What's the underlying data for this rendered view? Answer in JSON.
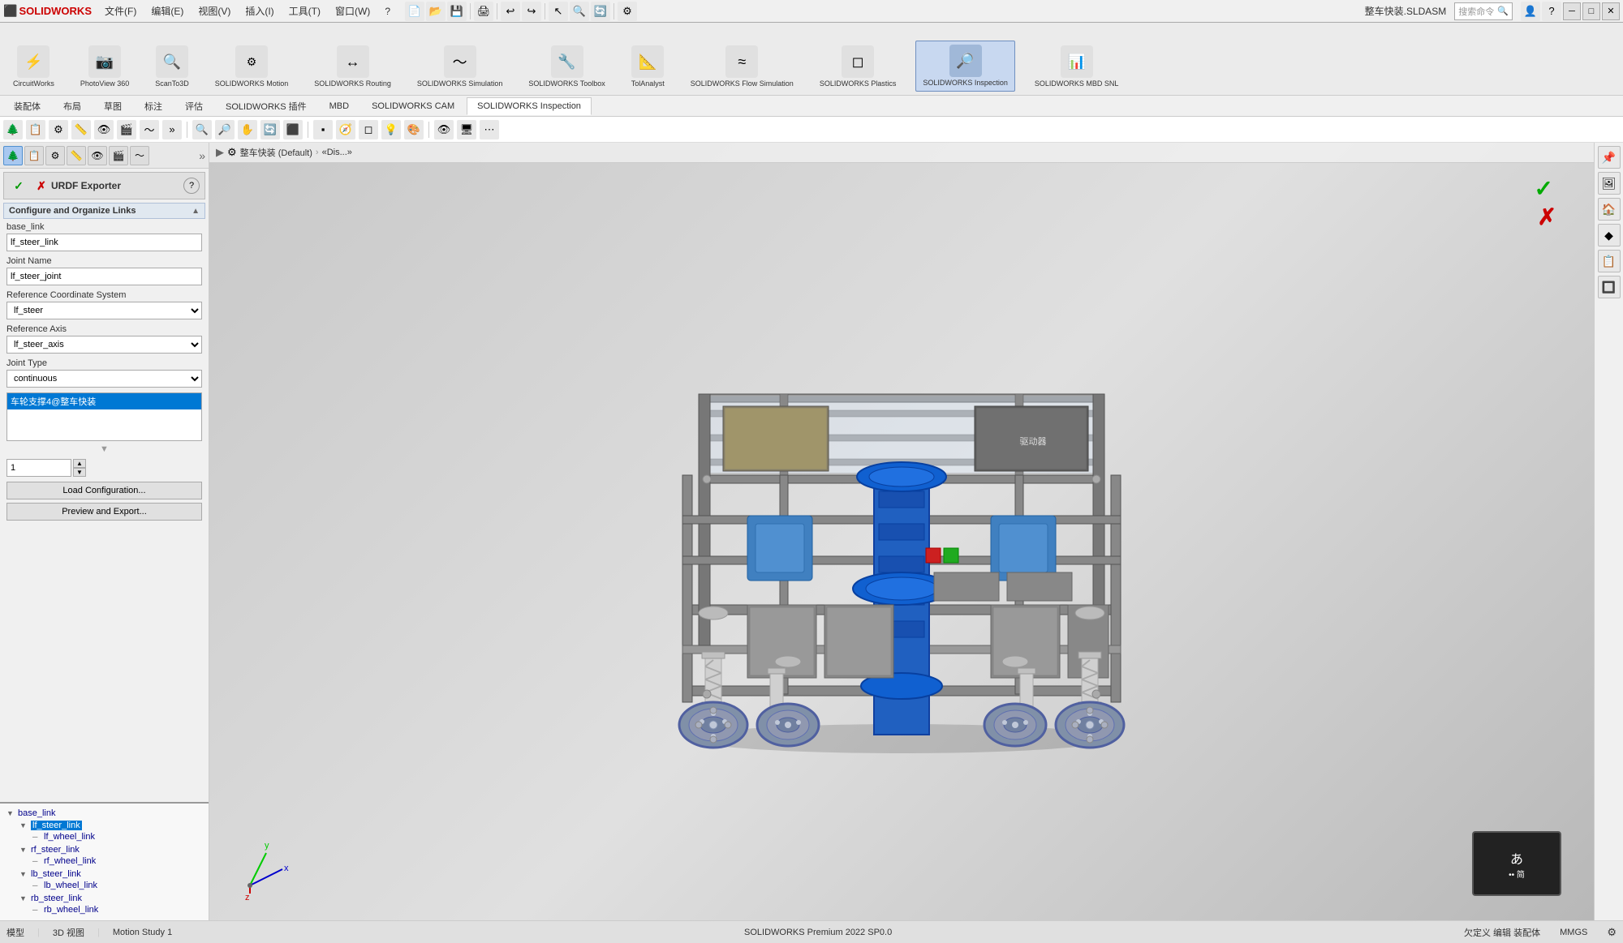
{
  "app": {
    "title": "整车快装.SLDASM",
    "logo": "SOLIDWORKS",
    "logo_color": "#cc0000"
  },
  "menu": {
    "items": [
      "文件(F)",
      "编辑(E)",
      "视图(V)",
      "插入(I)",
      "工具(T)",
      "窗口(W)",
      "?"
    ]
  },
  "addins": [
    {
      "label": "CircuitWorks",
      "icon": "⚡"
    },
    {
      "label": "PhotoView 360",
      "icon": "📷"
    },
    {
      "label": "ScanTo3D",
      "icon": "🔍"
    },
    {
      "label": "SOLIDWORKS Motion",
      "icon": "🔧"
    },
    {
      "label": "SOLIDWORKS Routing",
      "icon": "↔"
    },
    {
      "label": "SOLIDWORKS Simulation",
      "icon": "〜"
    },
    {
      "label": "SOLIDWORKS Toolbox",
      "icon": "🔨"
    },
    {
      "label": "TolAnalyst",
      "icon": "📐"
    },
    {
      "label": "SOLIDWORKS Flow Simulation",
      "icon": "≈"
    },
    {
      "label": "SOLIDWORKS Plastics",
      "icon": "◻"
    },
    {
      "label": "SOLIDWORKS Inspection",
      "icon": "🔎",
      "active": true
    },
    {
      "label": "SOLIDWORKS MBD SNL",
      "icon": "📊"
    }
  ],
  "ribbon_tabs": [
    "装配体",
    "布局",
    "草图",
    "标注",
    "评估",
    "SOLIDWORKS 插件",
    "MBD",
    "SOLIDWORKS CAM",
    "SOLIDWORKS Inspection"
  ],
  "breadcrumb": {
    "part": "整车快装 (Default)",
    "state": "«Dis...»"
  },
  "urdf_panel": {
    "title": "URDF Exporter",
    "help_label": "?",
    "check_btn": "✓",
    "x_btn": "✗",
    "section_title": "Configure and Organize Links",
    "section_toggle": "▲",
    "base_link_label": "base_link",
    "link_name_label": "lf_steer_link",
    "joint_name_label": "Joint Name",
    "joint_name_value": "lf_steer_joint",
    "ref_coord_label": "Reference Coordinate System",
    "ref_coord_value": "lf_steer",
    "ref_axis_label": "Reference Axis",
    "ref_axis_value": "lf_steer_axis",
    "joint_type_label": "Joint Type",
    "joint_type_value": "continuous",
    "listbox_item": "车轮支撑4@整车快装",
    "spinner_value": "1",
    "load_config_btn": "Load\nConfiguration...",
    "preview_export_btn": "Preview and\nExport..."
  },
  "tree": {
    "nodes": [
      {
        "label": "base_link",
        "level": 0,
        "expanded": true
      },
      {
        "label": "lf_steer_link",
        "level": 1,
        "expanded": true,
        "selected": true
      },
      {
        "label": "lf_wheel_link",
        "level": 2
      },
      {
        "label": "rf_steer_link",
        "level": 1,
        "expanded": true
      },
      {
        "label": "rf_wheel_link",
        "level": 2
      },
      {
        "label": "lb_steer_link",
        "level": 1,
        "expanded": true
      },
      {
        "label": "lb_wheel_link",
        "level": 2
      },
      {
        "label": "rb_steer_link",
        "level": 1,
        "expanded": true
      },
      {
        "label": "rb_wheel_link",
        "level": 2
      }
    ]
  },
  "status_bar": {
    "left": "SOLIDWORKS Premium 2022 SP0.0",
    "middle": "欠定义  编辑 装配体",
    "right": "MMGS"
  },
  "right_tools": [
    "📌",
    "🖼",
    "🏠",
    "🔶",
    "📋",
    "🔲"
  ],
  "viewport_check": "✓",
  "viewport_x": "✗"
}
